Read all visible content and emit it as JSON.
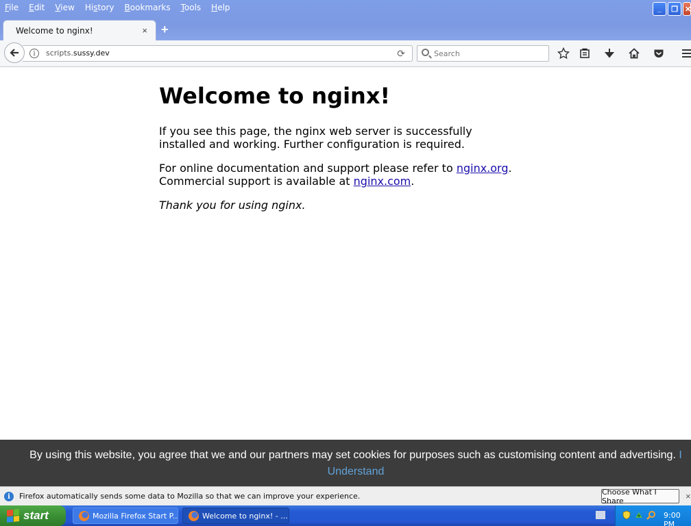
{
  "menu": {
    "items": [
      {
        "acc": "F",
        "rest": "ile"
      },
      {
        "acc": "E",
        "rest": "dit"
      },
      {
        "acc": "V",
        "rest": "iew"
      },
      {
        "acc": "",
        "pre": "Hi",
        "acc2": "s",
        "rest": "tory"
      },
      {
        "acc": "B",
        "rest": "ookmarks"
      },
      {
        "acc": "T",
        "rest": "ools"
      },
      {
        "acc": "H",
        "rest": "elp"
      }
    ]
  },
  "tab": {
    "label": "Welcome to nginx!",
    "close_icon": "×",
    "new_tab_icon": "+"
  },
  "navbar": {
    "url_prefix": "scripts.",
    "url_host": "sussy.dev",
    "search_placeholder": "Search"
  },
  "page": {
    "title": "Welcome to nginx!",
    "para1": "If you see this page, the nginx web server is successfully installed and working. Further configuration is required.",
    "para2_prefix": "For online documentation and support please refer to ",
    "link1": "nginx.org",
    "para2_mid": ".",
    "para2_line2": "Commercial support is available at ",
    "link2": "nginx.com",
    "para2_end": ".",
    "thanks": "Thank you for using nginx."
  },
  "cookie_banner": {
    "text": "By using this website, you agree that we and our partners may set cookies for purposes such as customising content and advertising.",
    "button": "I Understand"
  },
  "notification": {
    "text": "Firefox automatically sends some data to Mozilla so that we can improve your experience.",
    "button": "Choose What I Share",
    "close": "×"
  },
  "taskbar": {
    "start_label": "start",
    "items": [
      {
        "label": "Mozilla Firefox Start P..."
      },
      {
        "label": "Welcome to nginx! - ..."
      }
    ],
    "clock": "9:00 PM"
  },
  "colors": {
    "link": "#1a0dab",
    "cookie_bg": "#3c3c3c",
    "cookie_button": "#62a3d8",
    "taskbar_blue": "#245ad4",
    "start_green": "#3a8f34"
  }
}
